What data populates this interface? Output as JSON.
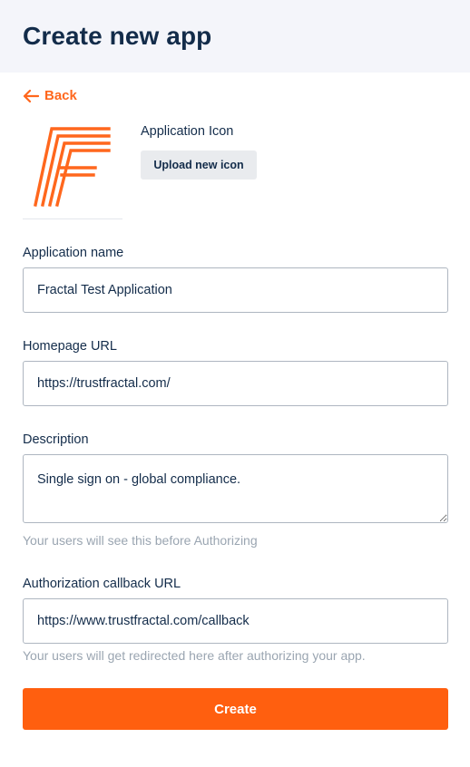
{
  "header": {
    "title": "Create new app"
  },
  "nav": {
    "back_label": "Back",
    "back_icon": "arrow-left-icon"
  },
  "icon_section": {
    "label": "Application Icon",
    "upload_label": "Upload new icon",
    "logo_icon": "fractal-logo"
  },
  "form": {
    "app_name": {
      "label": "Application name",
      "value": "Fractal Test Application"
    },
    "homepage_url": {
      "label": "Homepage URL",
      "value": "https://trustfractal.com/"
    },
    "description": {
      "label": "Description",
      "value": "Single sign on - global compliance.",
      "hint": "Your users will see this before Authorizing"
    },
    "callback_url": {
      "label": "Authorization callback URL",
      "value": "https://www.trustfractal.com/callback",
      "hint": "Your users will get redirected here after authorizing your app."
    },
    "submit_label": "Create"
  },
  "colors": {
    "accent": "#ff5f0f",
    "text": "#132c4a",
    "muted": "#9aa5b1",
    "header_bg": "#f4f5fa"
  }
}
